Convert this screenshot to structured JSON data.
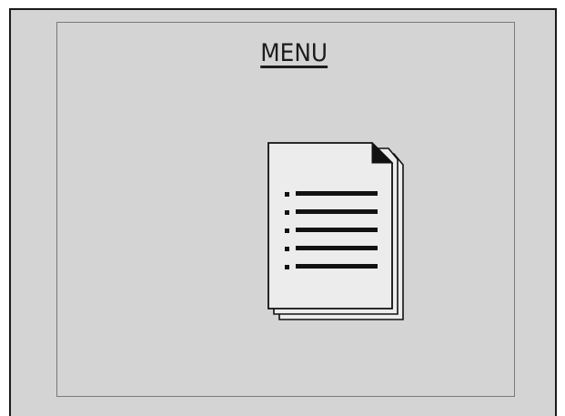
{
  "menu": {
    "title": "MENU",
    "icon": "document-stack-icon"
  },
  "colors": {
    "screen_background": "#d4d4d4",
    "frame_border": "#7a7a7a",
    "ink": "#1c1c1c"
  }
}
